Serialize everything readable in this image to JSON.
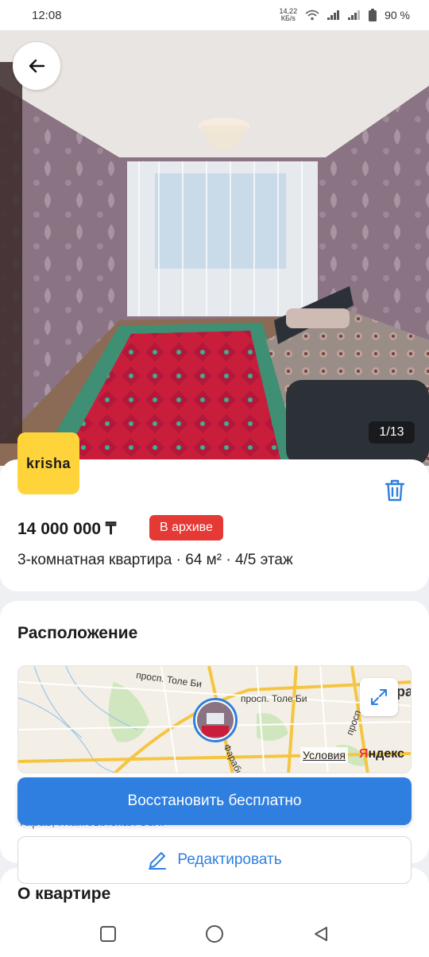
{
  "status": {
    "time": "12:08",
    "net_speed_value": "14,22",
    "net_speed_unit": "КБ/s",
    "battery": "90 %"
  },
  "gallery": {
    "counter": "1/13"
  },
  "listing": {
    "logo_text": "krisha",
    "price": "14 000 000 ₸",
    "badge": "В архиве",
    "subtitle": "3-комнатная квартира · 64 м² · 4/5 этаж"
  },
  "location": {
    "title": "Расположение",
    "map": {
      "street1": "просп. Толе Би",
      "street2": "просп. Толе Би",
      "street3": "Фараби",
      "street4": "просп.",
      "edge_text": "ра",
      "terms": "Условия",
      "brand_y": "Я",
      "brand_rest": "ндекс"
    },
    "address": "Тараз, Жамбылская обл."
  },
  "actions": {
    "restore_label": "Восстановить бесплатно",
    "edit_label": "Редактировать"
  },
  "about": {
    "title": "О квартире"
  },
  "colors": {
    "primary": "#2f7fe0",
    "badge": "#e53935",
    "logo_bg": "#ffd43b"
  }
}
